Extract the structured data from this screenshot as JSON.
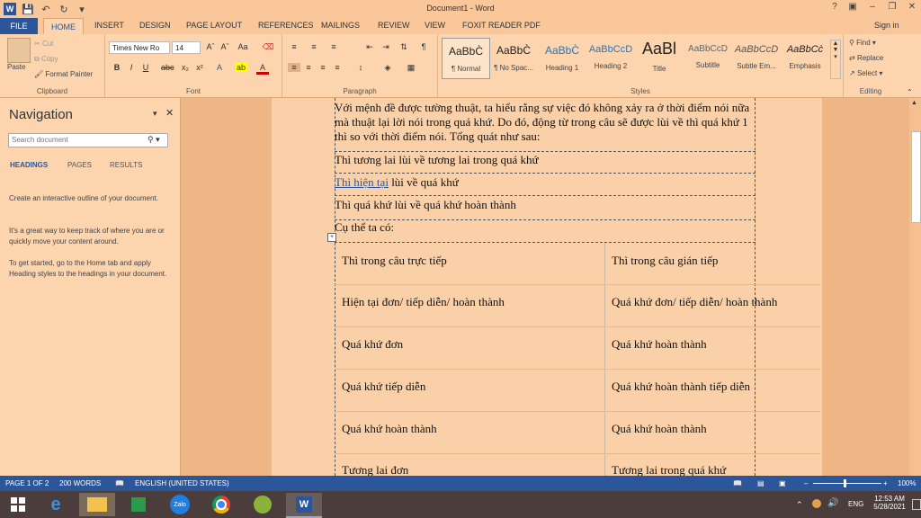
{
  "window": {
    "title": "Document1 - Word",
    "signin": "Sign in"
  },
  "tabs": [
    "FILE",
    "HOME",
    "INSERT",
    "DESIGN",
    "PAGE LAYOUT",
    "REFERENCES",
    "MAILINGS",
    "REVIEW",
    "VIEW",
    "FOXIT READER PDF"
  ],
  "ribbon": {
    "clipboard": {
      "paste": "Paste",
      "cut": "Cut",
      "copy": "Copy",
      "format_painter": "Format Painter",
      "label": "Clipboard"
    },
    "font": {
      "name": "Times New Ro",
      "size": "14",
      "label": "Font"
    },
    "paragraph": {
      "label": "Paragraph"
    },
    "styles": {
      "label": "Styles",
      "items": [
        {
          "preview": "AaBbC̀",
          "name": "¶ Normal"
        },
        {
          "preview": "AaBbC̀",
          "name": "¶ No Spac..."
        },
        {
          "preview": "AaBbC̀",
          "name": "Heading 1"
        },
        {
          "preview": "AaBbCcD",
          "name": "Heading 2"
        },
        {
          "preview": "AaBl",
          "name": "Title"
        },
        {
          "preview": "AaBbCcD",
          "name": "Subtitle"
        },
        {
          "preview": "AaBbCcD",
          "name": "Subtle Em..."
        },
        {
          "preview": "AaBbCc̀",
          "name": "Emphasis"
        }
      ]
    },
    "editing": {
      "find": "Find",
      "replace": "Replace",
      "select": "Select",
      "label": "Editing"
    }
  },
  "navigation": {
    "title": "Navigation",
    "search_placeholder": "Search document",
    "tabs": [
      "HEADINGS",
      "PAGES",
      "RESULTS"
    ],
    "help": [
      "Create an interactive outline of your document.",
      "It's a great way to keep track of where you are or quickly move your content around.",
      "To get started, go to the Home tab and apply Heading styles to the headings in your document."
    ]
  },
  "document": {
    "intro": "Với mệnh đề được tường thuật, ta hiểu rằng sự việc đó không xảy ra ở thời điểm nói nữa mà thuật lại lời nói trong quá khứ. Do đó, động từ trong câu sẽ được lùi về thì quá khứ 1 thì so với thời điểm nói. Tổng quát như sau:",
    "line1": "Thì tương lai lùi về tương lai trong quá khứ",
    "line2_link": "Thì hiện tại",
    "line2_rest": " lùi về quá khứ",
    "line3": "Thì quá khứ lùi về quá khứ hoàn thành",
    "line4": "Cụ thể ta có:",
    "table": [
      [
        "Thì trong câu trực tiếp",
        "Thì trong câu gián tiếp"
      ],
      [
        "Hiện tại đơn/ tiếp diễn/  hoàn thành",
        "Quá khứ đơn/ tiếp diễn/ hoàn thành"
      ],
      [
        "Quá khứ đơn",
        "Quá khứ hoàn thành"
      ],
      [
        "Quá khứ tiếp diễn",
        "Quá khứ hoàn thành tiếp diễn"
      ],
      [
        "Quá khứ hoàn thành",
        "Quá khứ hoàn thành"
      ],
      [
        "Tương lai đơn",
        "Tương lai trong quá khứ"
      ]
    ]
  },
  "status": {
    "page": "PAGE 1 OF 2",
    "words": "200 WORDS",
    "language": "ENGLISH (UNITED STATES)",
    "zoom": "100%"
  },
  "taskbar": {
    "lang": "ENG",
    "time": "12:53 AM",
    "date": "5/28/2021",
    "zalo": "Zalo"
  },
  "colors": {
    "accent": "#2b579a",
    "theme_bg": "#f5c090"
  }
}
